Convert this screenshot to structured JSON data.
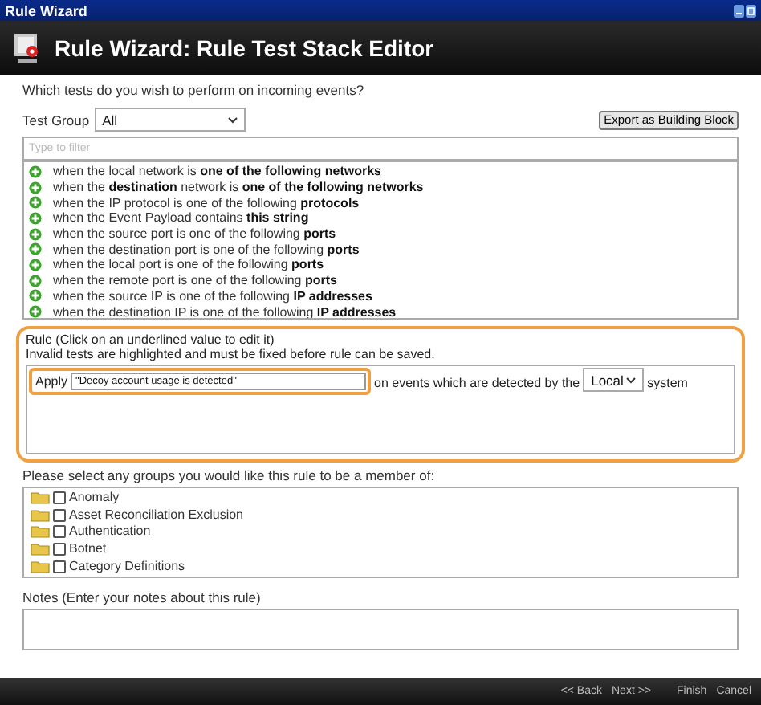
{
  "window": {
    "title": "Rule Wizard"
  },
  "header": {
    "title": "Rule Wizard: Rule Test Stack Editor"
  },
  "question": "Which tests do you wish to perform on incoming events?",
  "test_group": {
    "label": "Test Group",
    "value": "All"
  },
  "export_button": "Export as Building Block",
  "filter": {
    "placeholder": "Type to filter"
  },
  "tests": [
    {
      "text": "when the local network is **one of the following networks**"
    },
    {
      "text": "when the **destination** network is **one of the following networks**"
    },
    {
      "text": "when the IP protocol is one of the following **protocols**"
    },
    {
      "text": "when the Event Payload contains **this string**"
    },
    {
      "text": "when the source port is one of the following **ports**"
    },
    {
      "text": "when the destination port is one of the following **ports**"
    },
    {
      "text": "when the local port is one of the following **ports**"
    },
    {
      "text": "when the remote port is one of the following **ports**"
    },
    {
      "text": "when the source IP is one of the following **IP addresses**"
    },
    {
      "text": "when the destination IP is one of the following **IP addresses**"
    }
  ],
  "rule": {
    "title": "Rule (Click on an underlined value to edit it)",
    "hint": "Invalid tests are highlighted and must be fixed before rule can be saved.",
    "apply_label": "Apply",
    "rule_name": "\"Decoy account usage is detected\"",
    "middle_text": "on events which are detected by the",
    "system": "Local",
    "end_text": "system"
  },
  "groups": {
    "label": "Please select any groups you would like this rule to be a member of:",
    "items": [
      {
        "label": "Anomaly",
        "checked": false
      },
      {
        "label": "Asset Reconciliation Exclusion",
        "checked": false
      },
      {
        "label": "Authentication",
        "checked": false
      },
      {
        "label": "Botnet",
        "checked": false
      },
      {
        "label": "Category Definitions",
        "checked": false
      }
    ]
  },
  "notes": {
    "label": "Notes (Enter your notes about this rule)"
  },
  "footer": {
    "buttons": [
      {
        "label": "<< Back"
      },
      {
        "label": "Next >>"
      },
      {
        "label": "Finish"
      },
      {
        "label": "Cancel"
      }
    ]
  }
}
